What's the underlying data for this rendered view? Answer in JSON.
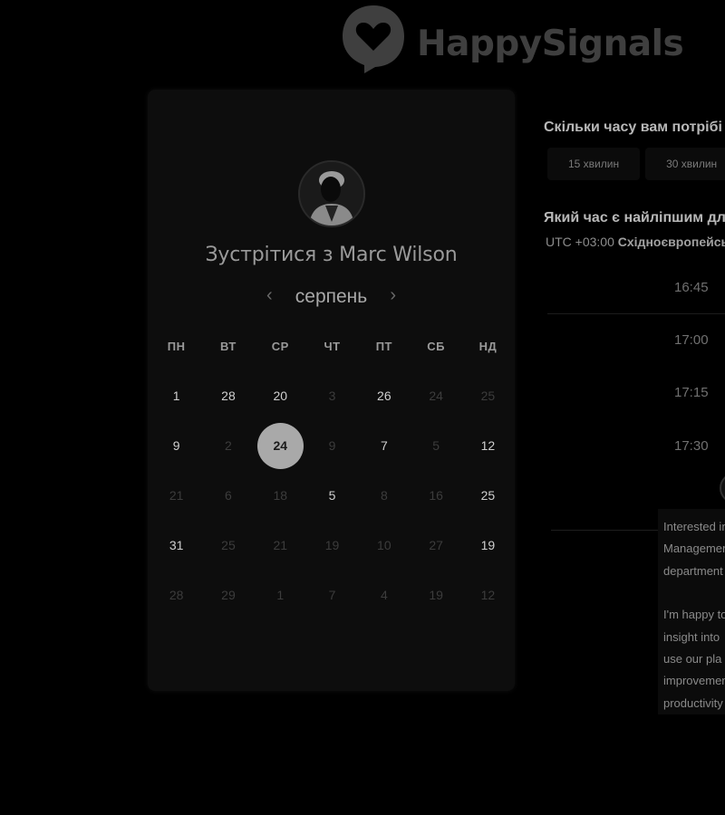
{
  "logo": {
    "text": "HappySignals",
    "icon": "heart-speech-bubble-icon",
    "color": "#3f3f3f"
  },
  "calendar": {
    "title": "Зустрітися з Marc Wilson",
    "avatar_icon": "user-avatar-photo",
    "month": "серпень",
    "prev_icon": "chevron-left-icon",
    "prev_glyph": "‹",
    "next_icon": "chevron-right-icon",
    "next_glyph": "›",
    "weekdays": [
      "ПН",
      "ВТ",
      "СР",
      "ЧТ",
      "ПТ",
      "СБ",
      "НД"
    ],
    "weeks": [
      [
        {
          "d": "1",
          "a": true
        },
        {
          "d": "28",
          "a": true
        },
        {
          "d": "20",
          "a": true
        },
        {
          "d": "3",
          "a": false
        },
        {
          "d": "26",
          "a": true
        },
        {
          "d": "24",
          "a": false
        },
        {
          "d": "25",
          "a": false
        }
      ],
      [
        {
          "d": "9",
          "a": true
        },
        {
          "d": "2",
          "a": false
        },
        {
          "d": "24",
          "a": true,
          "sel": true
        },
        {
          "d": "9",
          "a": false
        },
        {
          "d": "7",
          "a": true
        },
        {
          "d": "5",
          "a": false
        },
        {
          "d": "12",
          "a": true
        }
      ],
      [
        {
          "d": "21",
          "a": false
        },
        {
          "d": "6",
          "a": false
        },
        {
          "d": "18",
          "a": false
        },
        {
          "d": "5",
          "a": true
        },
        {
          "d": "8",
          "a": false
        },
        {
          "d": "16",
          "a": false
        },
        {
          "d": "25",
          "a": true
        }
      ],
      [
        {
          "d": "31",
          "a": true
        },
        {
          "d": "25",
          "a": false
        },
        {
          "d": "21",
          "a": false
        },
        {
          "d": "19",
          "a": false
        },
        {
          "d": "10",
          "a": false
        },
        {
          "d": "27",
          "a": false
        },
        {
          "d": "19",
          "a": true
        }
      ],
      [
        {
          "d": "28",
          "a": false
        },
        {
          "d": "29",
          "a": false
        },
        {
          "d": "1",
          "a": false
        },
        {
          "d": "7",
          "a": false
        },
        {
          "d": "4",
          "a": false
        },
        {
          "d": "19",
          "a": false
        },
        {
          "d": "12",
          "a": false
        }
      ]
    ],
    "selected_color": "#a9a9a9"
  },
  "booking": {
    "duration_question": "Скільки часу вам потрібі",
    "durations": [
      "15 хвилин",
      "30 хвилин"
    ],
    "time_question": "Який час є найліпшим дл",
    "tz_offset": "UTC +03:00",
    "tz_name": "Східноєвропейсь",
    "slots": [
      "16:45",
      "17:00",
      "17:15",
      "17:30"
    ]
  },
  "chat": {
    "paragraph1": "Interested in\nManagement\ndepartment",
    "paragraph2": "I'm happy to\ninsight into\nuse our pla\nimprovement\nproductivity"
  }
}
